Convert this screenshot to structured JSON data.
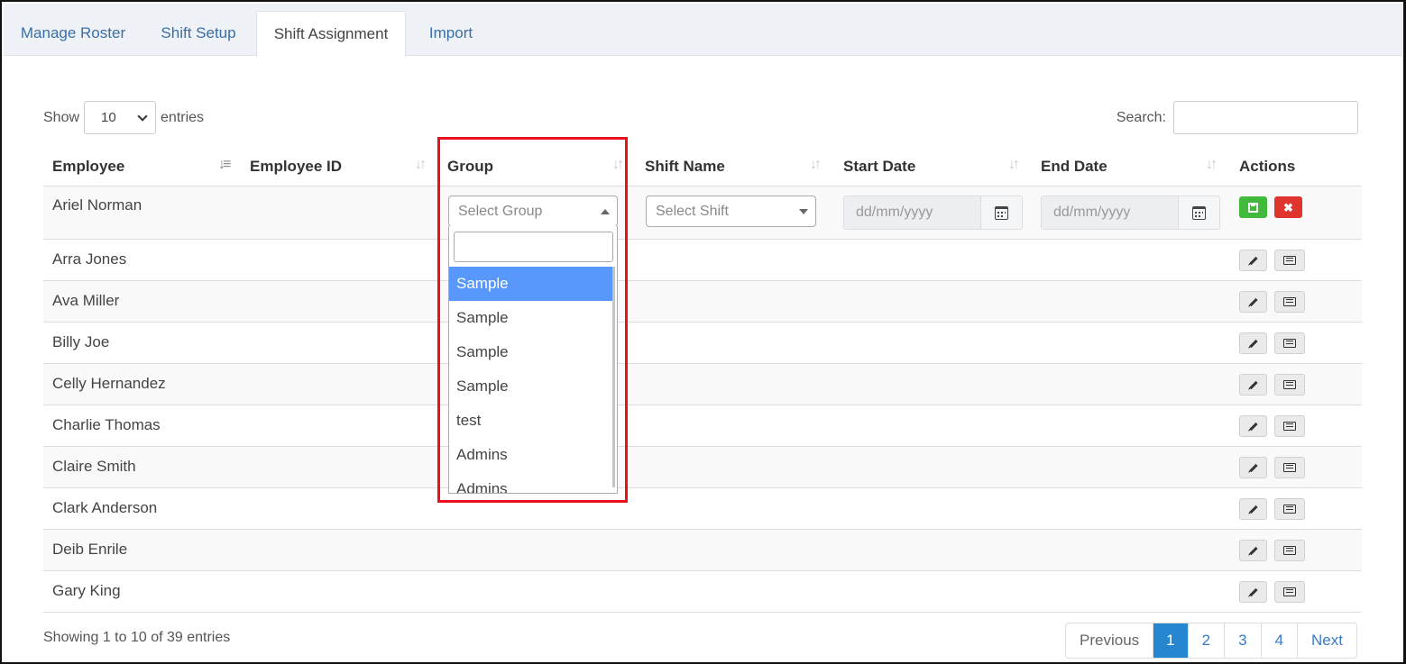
{
  "tabs": [
    "Manage Roster",
    "Shift Setup",
    "Shift Assignment",
    "Import"
  ],
  "active_tab": "Shift Assignment",
  "length_menu": {
    "label_before": "Show",
    "selected": "10",
    "label_after": "entries"
  },
  "search": {
    "label": "Search:",
    "value": ""
  },
  "columns": [
    "Employee",
    "Employee ID",
    "Group",
    "Shift Name",
    "Start Date",
    "End Date",
    "Actions"
  ],
  "edit_row": {
    "employee": "Ariel Norman",
    "group_placeholder": "Select Group",
    "shift_placeholder": "Select Shift",
    "start_date_placeholder": "dd/mm/yyyy",
    "end_date_placeholder": "dd/mm/yyyy"
  },
  "rows": [
    "Arra Jones",
    "Ava Miller",
    "Billy Joe",
    "Celly Hernandez",
    "Charlie Thomas",
    "Claire Smith",
    "Clark Anderson",
    "Deib Enrile",
    "Gary King"
  ],
  "group_dropdown": {
    "search_value": "",
    "options": [
      "Sample",
      "Sample",
      "Sample",
      "Sample",
      "test",
      "Admins",
      "Admins"
    ],
    "highlighted_index": 0
  },
  "footer": {
    "info": "Showing 1 to 10 of 39 entries",
    "pagination": [
      "Previous",
      "1",
      "2",
      "3",
      "4",
      "Next"
    ],
    "current_page": "1"
  },
  "colors": {
    "accent": "#2687d0",
    "highlight_option": "#5897fb",
    "annotation_box": "#e8101a",
    "save": "#41b93a",
    "cancel": "#e0352e"
  }
}
